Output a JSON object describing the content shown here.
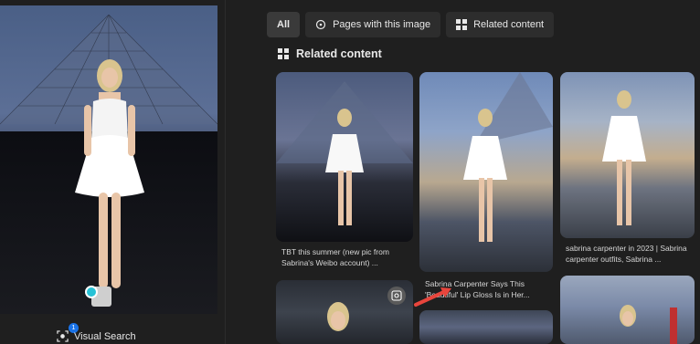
{
  "tabs": [
    {
      "label": "All",
      "active": true
    },
    {
      "label": "Pages with this image",
      "icon": "pages-icon"
    },
    {
      "label": "Related content",
      "icon": "grid-icon"
    }
  ],
  "section": {
    "title": "Related content",
    "icon": "grid-icon"
  },
  "visual_search": {
    "label": "Visual Search",
    "badge": "1",
    "icon": "visual-search-icon"
  },
  "cards": [
    {
      "caption": "TBT this summer (new pic from Sabrina's Weibo account) ..."
    },
    {
      "caption": "Sabrina Carpenter Says This 'Beautiful' Lip Gloss Is in Her..."
    },
    {
      "caption": "sabrina carpenter in 2023 | Sabrina carpenter outfits, Sabrina ..."
    }
  ],
  "colors": {
    "accent": "#27c2d6",
    "annotation_arrow": "#e8453c",
    "badge": "#1a73e8"
  }
}
